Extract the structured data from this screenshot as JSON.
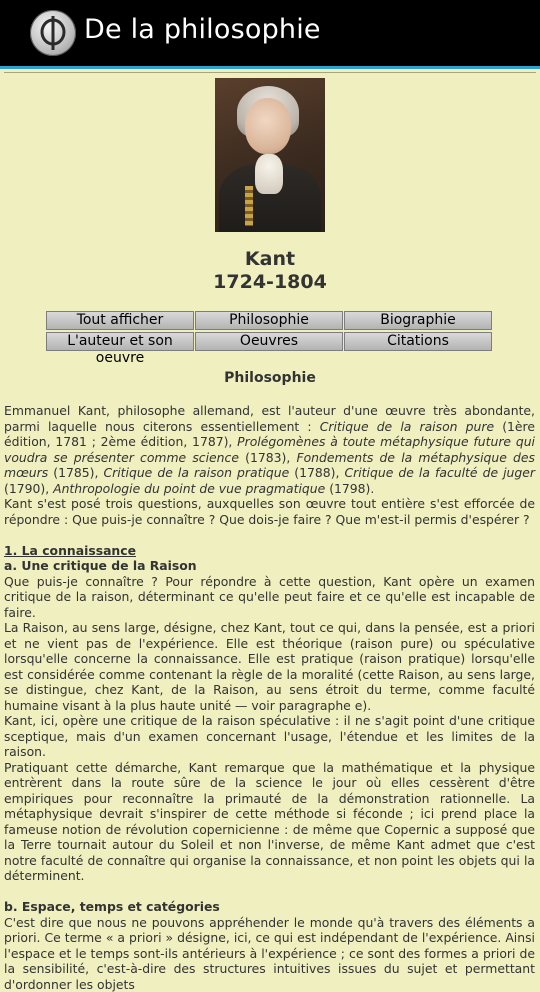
{
  "app": {
    "title": "De la philosophie",
    "logo_icon": "phi-icon"
  },
  "person": {
    "name": "Kant",
    "dates": "1724-1804"
  },
  "buttons": [
    {
      "label": "Tout afficher"
    },
    {
      "label": "Philosophie"
    },
    {
      "label": "Biographie"
    },
    {
      "label": "L'auteur et son oeuvre"
    },
    {
      "label": "Oeuvres"
    },
    {
      "label": "Citations"
    }
  ],
  "section": {
    "title": "Philosophie"
  },
  "content": {
    "p1_a": "Emmanuel Kant, philosophe allemand, est l'auteur d'une œuvre très abondante, parmi laquelle nous citerons essentiellement : ",
    "p1_w1": "Critique de la raison pure",
    "p1_b": " (1ère édition, 1781 ; 2ème édition, 1787), ",
    "p1_w2": "Prolégomènes à toute métaphysique future qui voudra se présenter comme science",
    "p1_c": " (1783), ",
    "p1_w3": "Fondements de la métaphysique des mœurs",
    "p1_d": " (1785), ",
    "p1_w4": "Critique de la raison pratique",
    "p1_e": " (1788), ",
    "p1_w5": "Critique de la faculté de juger",
    "p1_f": " (1790), ",
    "p1_w6": "Anthropologie du point de vue pragmatique",
    "p1_g": " (1798).",
    "p2": "Kant s'est posé trois questions, auxquelles son œuvre tout entière s'est efforcée de répondre : Que puis-je connaître ? Que dois-je faire ? Que m'est-il permis d'espérer ?",
    "h1": "1. La connaissance",
    "h1a": "a. Une critique de la Raison",
    "p3": "Que puis-je connaître ? Pour répondre à cette question, Kant opère un examen critique de la raison, déterminant ce qu'elle peut faire et ce qu'elle est incapable de faire.",
    "p4": "La Raison, au sens large, désigne, chez Kant, tout ce qui, dans la pensée, est a priori et ne vient pas de l'expérience. Elle est théorique (raison pure) ou spéculative lorsqu'elle concerne la connaissance. Elle est pratique (raison pratique) lorsqu'elle est considérée comme contenant la règle de la moralité (cette Raison, au sens large, se distingue, chez Kant, de la Raison, au sens étroit du terme, comme faculté humaine visant à la plus haute unité — voir paragraphe e).",
    "p5": "Kant, ici, opère une critique de la raison spéculative : il ne s'agit point d'une critique sceptique, mais d'un examen concernant l'usage, l'étendue et les limites de la raison.",
    "p6": "Pratiquant cette démarche, Kant remarque que la mathématique et la physique entrèrent dans la route sûre de la science le jour où elles cessèrent d'être empiriques pour reconnaître la primauté de la démonstration rationnelle. La métaphysique devrait s'inspirer de cette méthode si féconde ; ici prend place la fameuse notion de révolution copernicienne : de même que Copernic a supposé que la Terre tournait autour du Soleil et non l'inverse, de même Kant admet que c'est notre faculté de connaître qui organise la connaissance, et non point les objets qui la déterminent.",
    "h1b": "b. Espace, temps et catégories",
    "p7": "C'est dire que nous ne pouvons appréhender le monde qu'à travers des éléments a priori. Ce terme « a priori » désigne, ici, ce qui est indépendant de l'expérience. Ainsi l'espace et le temps sont-ils antérieurs à l'expérience ; ce sont des formes a priori de la sensibilité, c'est-à-dire des structures intuitives issues du sujet et permettant d'ordonner les objets"
  }
}
